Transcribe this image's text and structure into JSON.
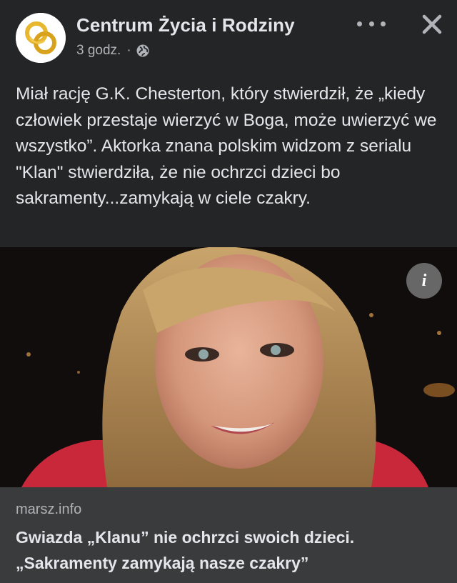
{
  "post": {
    "page_name": "Centrum Życia i Rodziny",
    "time": "3 godz.",
    "separator": "·",
    "privacy_icon": "globe-icon",
    "more_icon": "more-options-icon",
    "close_icon": "close-icon",
    "text": "Miał rację G.K. Chesterton, który stwierdził, że „kiedy człowiek przestaje wierzyć w Boga, może uwierzyć we wszystko”. Aktorka znana polskim widzom z serialu \"Klan\" stwierdziła, że nie ochrzci dzieci bo sakramenty...zamykają w ciele czakry."
  },
  "link": {
    "info_label": "i",
    "domain": "marsz.info",
    "title": "Gwiazda „Klanu” nie ochrzci swoich dzieci. „Sakramenty zamykają nasze czakry”"
  },
  "colors": {
    "background": "#242526",
    "link_box": "#3a3b3c",
    "text_primary": "#e4e6eb",
    "text_secondary": "#b0b3b8",
    "logo_gold": "#e8b730"
  }
}
